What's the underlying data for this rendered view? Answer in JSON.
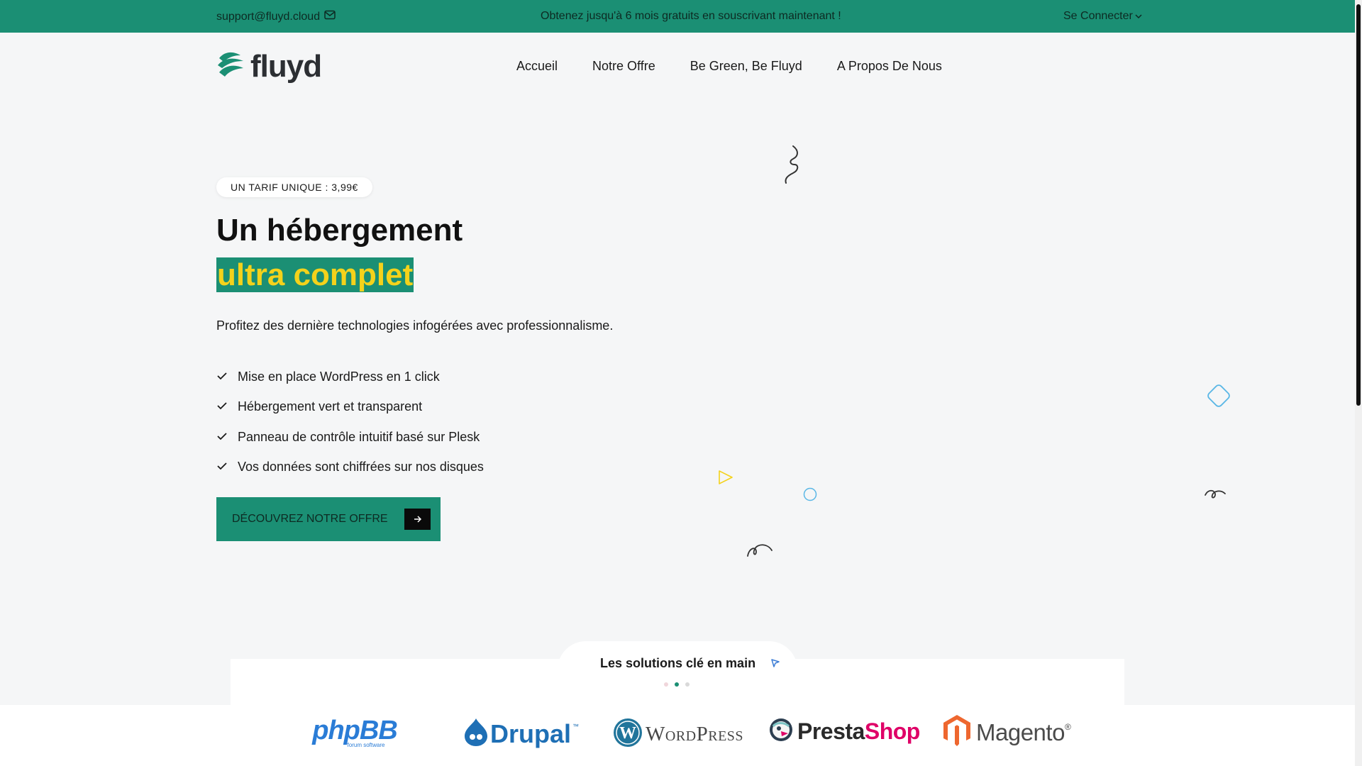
{
  "topbar": {
    "email": "support@fluyd.cloud",
    "promo": "Obtenez jusqu'à 6 mois gratuits en souscrivant maintenant !",
    "login": "Se Connecter"
  },
  "brand": {
    "name": "fluyd"
  },
  "nav": {
    "items": [
      "Accueil",
      "Notre Offre",
      "Be Green, Be Fluyd",
      "A Propos De Nous"
    ]
  },
  "hero": {
    "badge": "UN TARIF UNIQUE : 3,99€",
    "title_line1": "Un hébergement",
    "title_line2": "ultra complet",
    "lead": "Profitez des dernière technologies infogérées avec professionnalisme.",
    "features": [
      "Mise en place WordPress en 1 click",
      "Hébergement vert et transparent",
      "Panneau de contrôle intuitif basé sur Plesk",
      "Vos données sont chiffrées sur nos disques"
    ],
    "cta": "DÉCOUVREZ NOTRE OFFRE"
  },
  "solutions": {
    "title": "Les solutions clé en main",
    "carousel_active_index": 1,
    "logos": [
      {
        "name": "phpBB",
        "sub": "forum software"
      },
      {
        "name": "Drupal",
        "sub": "™"
      },
      {
        "name": "WordPress",
        "sub": ""
      },
      {
        "name": "PrestaShop",
        "sub": ""
      },
      {
        "name": "Magento",
        "sub": "®"
      }
    ]
  },
  "colors": {
    "accent": "#1b8f74",
    "highlight": "#f4d21b",
    "background": "#f5f6f7"
  }
}
